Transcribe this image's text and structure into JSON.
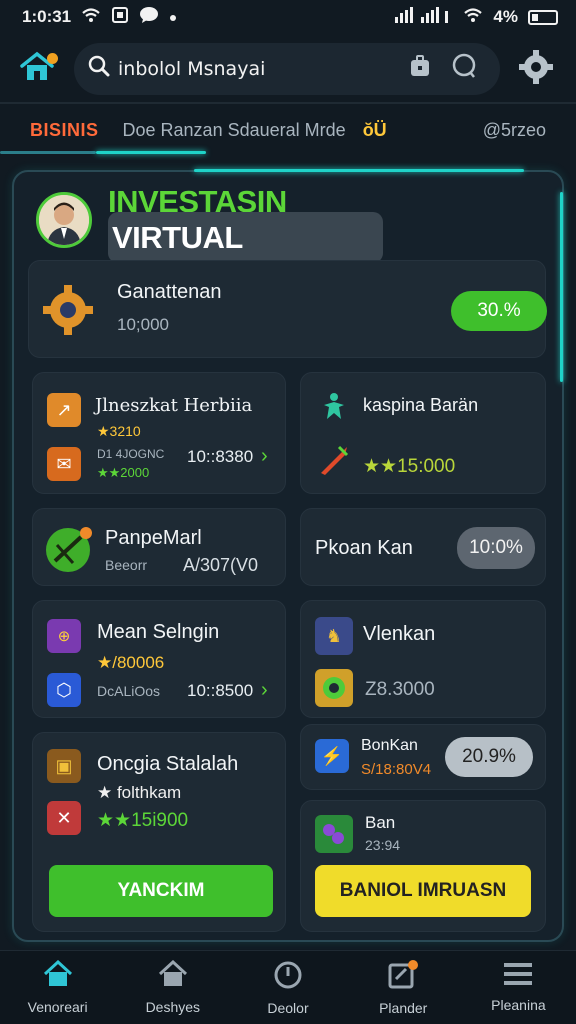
{
  "status_bar": {
    "time": "1:0:31",
    "battery": "4%"
  },
  "search": {
    "text": "inbolol Msnayai"
  },
  "ticker": {
    "label": "BISINIS",
    "text": "Doe Ranzan Sdaueral Mrde",
    "icon_text": "ŏÜ",
    "right": "@5rzeo"
  },
  "panel": {
    "title_green": "INVESTASIN",
    "title_white": "VIRTUAL"
  },
  "summary": {
    "title": "Ganattenan",
    "value": "10;000",
    "badge": "30.%"
  },
  "cards": {
    "c1": {
      "title": "Jlneszkat Herbiia",
      "sub": "★3210",
      "line1": "D1 4JOGNC",
      "line2": "★★2000",
      "value": "10::8380"
    },
    "c2": {
      "title": "kaspina Barän",
      "value": "★★15:000"
    },
    "c3": {
      "title": "PanpeMarl",
      "sub": "Beeorr",
      "value": "A/307(V0"
    },
    "c4": {
      "title": "Pkoan Kan",
      "badge": "10:0%"
    },
    "c5": {
      "title": "Mean Selngin",
      "sub": "★/80006",
      "line": "DcALiOos",
      "value": "10::8500"
    },
    "c6": {
      "title": "Vlenkan",
      "value": "Z8.3000"
    },
    "c7": {
      "title": "Oncgia Stalalah",
      "sub": "★ folthkam",
      "value": "★★15i900"
    },
    "c8": {
      "title": "BonKan",
      "sub": "S/18:80V4",
      "badge": "20.9%"
    },
    "c9": {
      "title": "Ban",
      "sub": "23:94"
    }
  },
  "buttons": {
    "green": "YANCKIM",
    "yellow": "BANIOL IMRUASN"
  },
  "nav": [
    {
      "label": "Venoreari"
    },
    {
      "label": "Deshyes"
    },
    {
      "label": "Deolor"
    },
    {
      "label": "Plander"
    },
    {
      "label": "Pleanina"
    }
  ],
  "colors": {
    "accent_green": "#5cd638",
    "accent_cyan": "#1fd3c8",
    "accent_yellow": "#f0dc2a",
    "ticker_orange": "#ff6a3a",
    "background": "#111a22"
  }
}
